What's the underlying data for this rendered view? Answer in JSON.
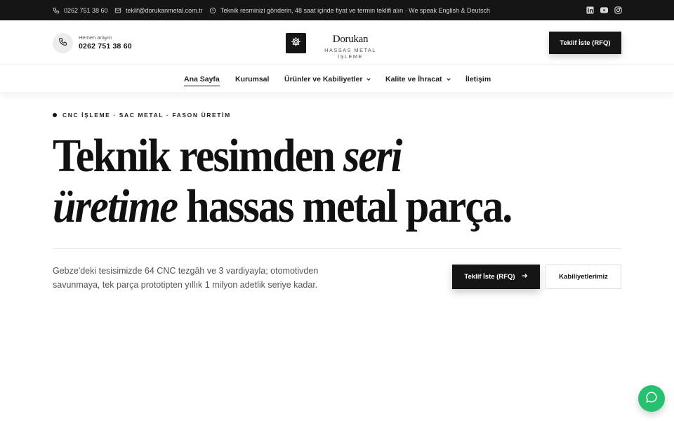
{
  "topbar": {
    "phone": "0262 751 38 60",
    "email": "teklif@dorukanmetal.com.tr",
    "notice": "Teknik resminizi gönderin, 48 saat içinde fiyat ve termin teklifi alın · We speak English & Deutsch",
    "icons": [
      "phone-icon",
      "mail-icon",
      "clock-icon",
      "linkedin-icon",
      "youtube-icon",
      "instagram-icon"
    ]
  },
  "header": {
    "call_label": "Hemen arayın",
    "call_number": "0262 751 38 60",
    "logo_icon": "gear-icon",
    "brand_name": "Dorukan",
    "brand_tagline": "HASSAS METAL İŞLEME",
    "rfq_label": "Teklif İste (RFQ)"
  },
  "nav": {
    "items": [
      {
        "label": "Ana Sayfa",
        "active": true
      },
      {
        "label": "Kurumsal"
      },
      {
        "label": "Ürünler ve Kabiliyetler",
        "dropdown": true
      },
      {
        "label": "Kalite ve İhracat",
        "dropdown": true
      },
      {
        "label": "İletişim"
      }
    ]
  },
  "hero": {
    "eyebrow": "CNC İŞLEME · SAC METAL · FASON ÜRETİM",
    "headline": {
      "line1_a": "Teknik resimden ",
      "line1_b": "seri",
      "line2_a": "üretime",
      "line2_b": " hassas metal parça."
    },
    "description": "Gebze'deki tesisimizde 64 CNC tezgâh ve 3 vardiyayla; otomotivden savunmaya, tek parça prototipten yıllık 1 milyon adetlik seriye kadar.",
    "primary_cta": "Teklif İste (RFQ)",
    "secondary_cta": "Kabiliyetlerimiz"
  },
  "colors": {
    "dark": "#151515",
    "chat_green": "#25c16f"
  }
}
